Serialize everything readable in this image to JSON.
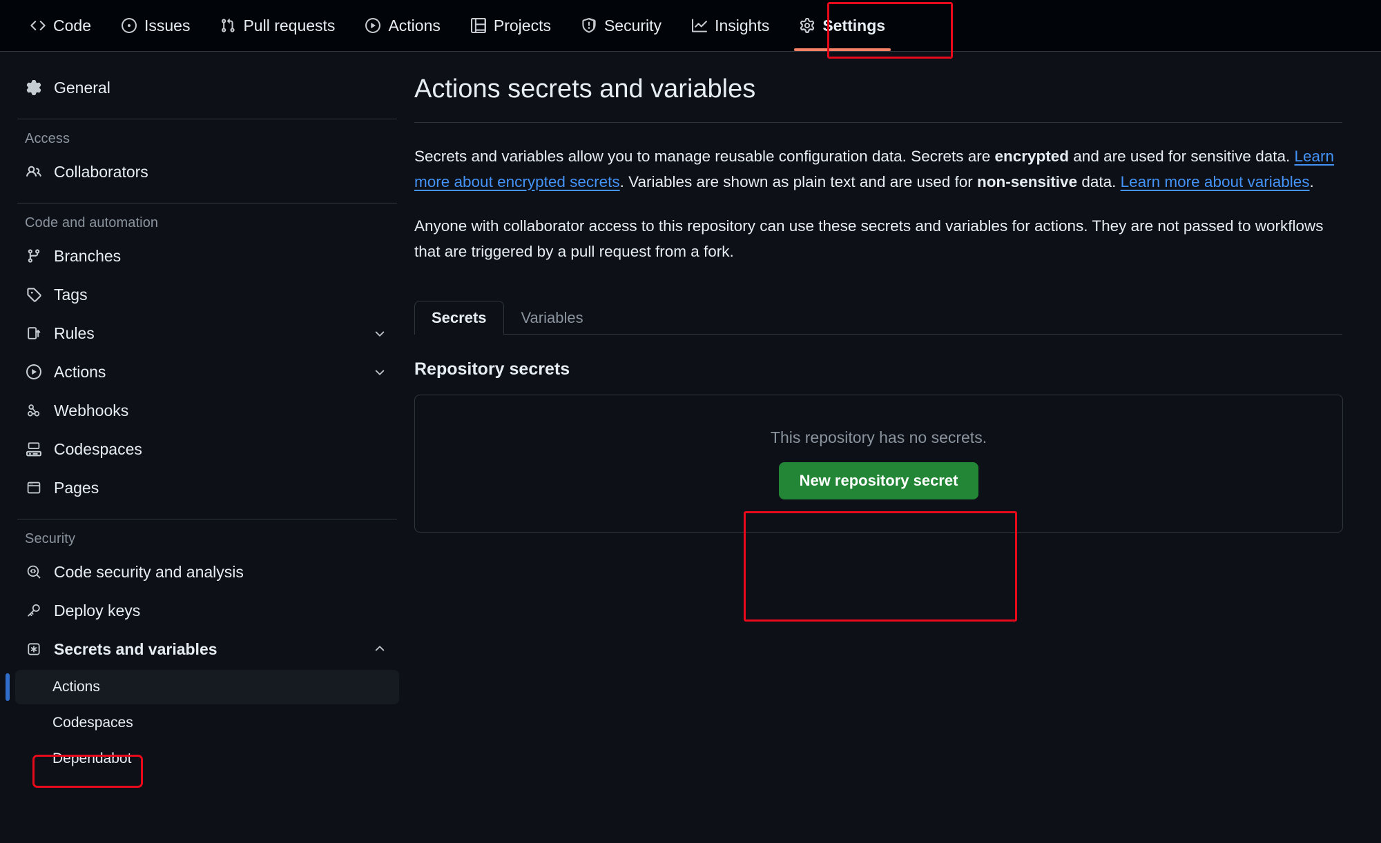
{
  "topnav": {
    "items": [
      {
        "label": "Code",
        "icon": "code-icon",
        "active": false
      },
      {
        "label": "Issues",
        "icon": "issue-opened-icon",
        "active": false
      },
      {
        "label": "Pull requests",
        "icon": "git-pull-request-icon",
        "active": false
      },
      {
        "label": "Actions",
        "icon": "play-icon",
        "active": false
      },
      {
        "label": "Projects",
        "icon": "table-icon",
        "active": false
      },
      {
        "label": "Security",
        "icon": "shield-icon",
        "active": false
      },
      {
        "label": "Insights",
        "icon": "graph-icon",
        "active": false
      },
      {
        "label": "Settings",
        "icon": "gear-icon",
        "active": true
      }
    ]
  },
  "sidebar": {
    "general": {
      "label": "General",
      "icon": "gear-icon"
    },
    "groups": [
      {
        "title": "Access",
        "items": [
          {
            "label": "Collaborators",
            "icon": "people-icon",
            "expandable": false
          }
        ]
      },
      {
        "title": "Code and automation",
        "items": [
          {
            "label": "Branches",
            "icon": "git-branch-icon",
            "expandable": false
          },
          {
            "label": "Tags",
            "icon": "tag-icon",
            "expandable": false
          },
          {
            "label": "Rules",
            "icon": "rules-icon",
            "expandable": true,
            "expanded": false
          },
          {
            "label": "Actions",
            "icon": "play-icon",
            "expandable": true,
            "expanded": false
          },
          {
            "label": "Webhooks",
            "icon": "webhook-icon",
            "expandable": false
          },
          {
            "label": "Codespaces",
            "icon": "codespaces-icon",
            "expandable": false
          },
          {
            "label": "Pages",
            "icon": "browser-icon",
            "expandable": false
          }
        ]
      },
      {
        "title": "Security",
        "items": [
          {
            "label": "Code security and analysis",
            "icon": "code-scan-icon",
            "expandable": false
          },
          {
            "label": "Deploy keys",
            "icon": "key-icon",
            "expandable": false
          },
          {
            "label": "Secrets and variables",
            "icon": "asterisk-key-icon",
            "expandable": true,
            "expanded": true,
            "bold": true
          }
        ]
      }
    ],
    "secrets_subitems": [
      {
        "label": "Actions",
        "selected": true
      },
      {
        "label": "Codespaces",
        "selected": false
      },
      {
        "label": "Dependabot",
        "selected": false
      }
    ]
  },
  "main": {
    "title": "Actions secrets and variables",
    "paragraph1": {
      "seg1": "Secrets and variables allow you to manage reusable configuration data. Secrets are ",
      "bold1": "encrypted",
      "seg2": " and are used for sensitive data. ",
      "link1": "Learn more about encrypted secrets",
      "seg3": ". Variables are shown as plain text and are used for ",
      "bold2": "non-sensitive",
      "seg4": " data. ",
      "link2": "Learn more about variables",
      "seg5": "."
    },
    "paragraph2": "Anyone with collaborator access to this repository can use these secrets and variables for actions. They are not passed to workflows that are triggered by a pull request from a fork.",
    "tabs": [
      {
        "label": "Secrets",
        "active": true
      },
      {
        "label": "Variables",
        "active": false
      }
    ],
    "section_title": "Repository secrets",
    "empty_state": {
      "text": "This repository has no secrets.",
      "button_label": "New repository secret"
    }
  },
  "colors": {
    "background": "#0d1117",
    "header_background": "#010409",
    "border": "#30363d",
    "text": "#e6edf3",
    "muted_text": "#8b949e",
    "link": "#4493f8",
    "accent_green": "#238636",
    "active_tab_underline": "#f78166",
    "selected_indicator": "#316dca",
    "annotation": "#e8091a"
  }
}
